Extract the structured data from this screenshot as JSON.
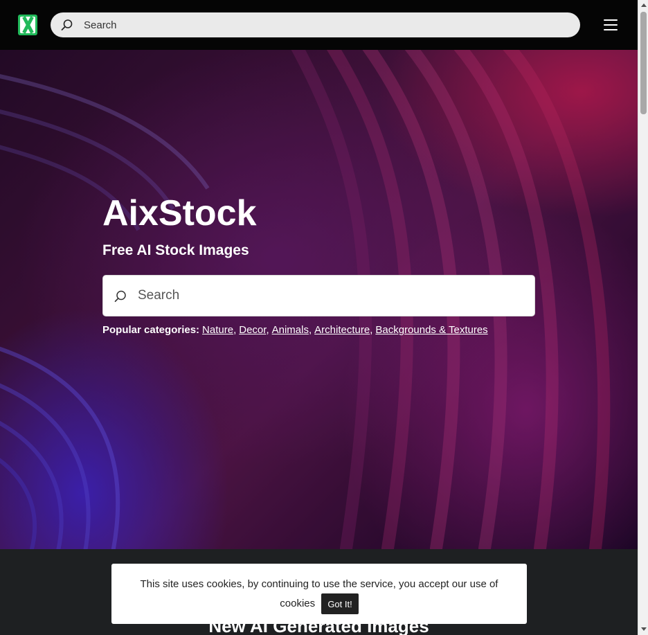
{
  "navbar": {
    "logo_icon": "aixstock-logo-icon",
    "search_icon": "search-icon",
    "search_placeholder": "Search",
    "menu_icon": "hamburger-menu-icon"
  },
  "hero": {
    "title": "AixStock",
    "subtitle": "Free AI Stock Images",
    "search_icon": "search-icon",
    "search_placeholder": "Search",
    "popular_label": "Popular categories:",
    "categories": [
      "Nature",
      "Decor",
      "Animals",
      "Architecture",
      "Backgrounds & Textures"
    ]
  },
  "section": {
    "title": "New AI Generated Images"
  },
  "cookie": {
    "text_line1": "This site uses cookies, by continuing to use the service, you accept our use of",
    "text_line2": "cookies",
    "button_label": "Got It!"
  },
  "colors": {
    "navbar_bg": "#050505",
    "logo_green": "#21b95a",
    "page_bg": "#1e2022"
  }
}
